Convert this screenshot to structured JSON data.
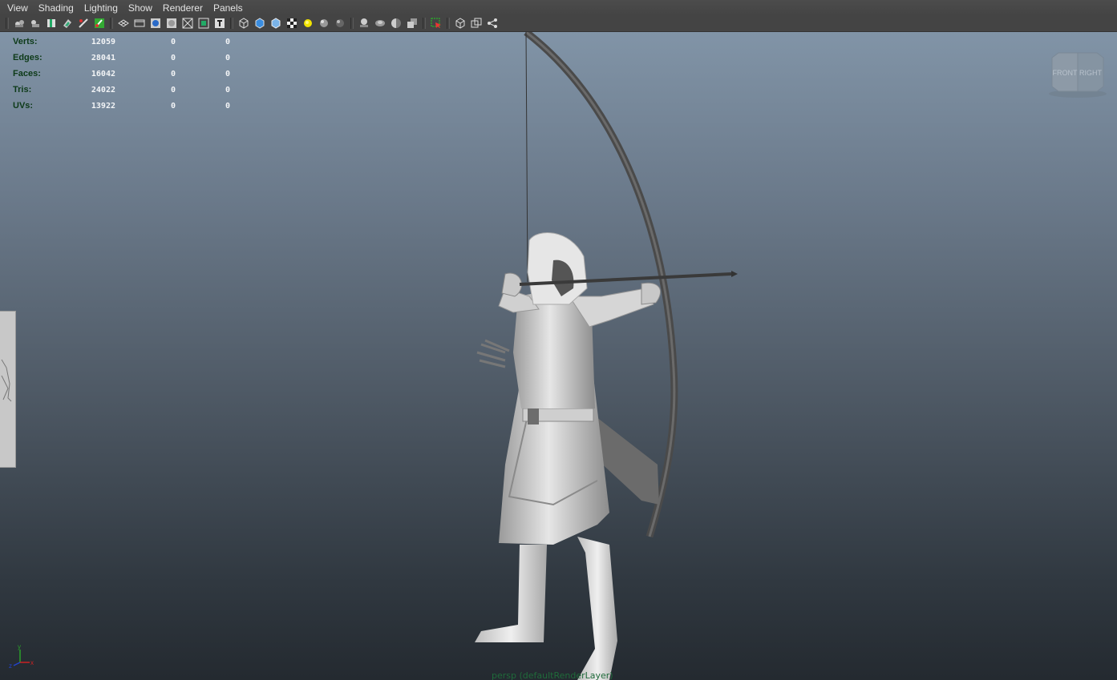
{
  "menubar": {
    "items": [
      "View",
      "Shading",
      "Lighting",
      "Show",
      "Renderer",
      "Panels"
    ]
  },
  "toolbar": {
    "icons": [
      "select-camera-icon",
      "camera-attributes-icon",
      "bookmark-icon",
      "image-plane-icon",
      "xray-icon",
      "grease-pencil-icon",
      "grid-icon",
      "film-gate-icon",
      "resolution-gate-icon",
      "gate-mask-icon",
      "field-chart-icon",
      "title-safe-icon",
      "wireframe-icon",
      "smooth-shade-icon",
      "default-material-icon",
      "textured-icon",
      "lights-icon",
      "shadows-icon",
      "ao-icon",
      "xray-joints-icon",
      "xray-active-icon",
      "motion-blur-icon",
      "multisample-icon",
      "isolate-select-icon",
      "single-view-icon",
      "two-view-icon",
      "node-editor-icon"
    ]
  },
  "hud": {
    "rows": [
      {
        "label": "Verts:",
        "c1": "12059",
        "c2": "0",
        "c3": "0"
      },
      {
        "label": "Edges:",
        "c1": "28041",
        "c2": "0",
        "c3": "0"
      },
      {
        "label": "Faces:",
        "c1": "16042",
        "c2": "0",
        "c3": "0"
      },
      {
        "label": "Tris:",
        "c1": "24022",
        "c2": "0",
        "c3": "0"
      },
      {
        "label": "UVs:",
        "c1": "13922",
        "c2": "0",
        "c3": "0"
      }
    ]
  },
  "viewcube": {
    "front": "FRONT",
    "right": "RIGHT"
  },
  "axis": {
    "y": "y",
    "x": "x",
    "z": "z"
  },
  "camera_label": "persp (defaultRenderLayer)"
}
